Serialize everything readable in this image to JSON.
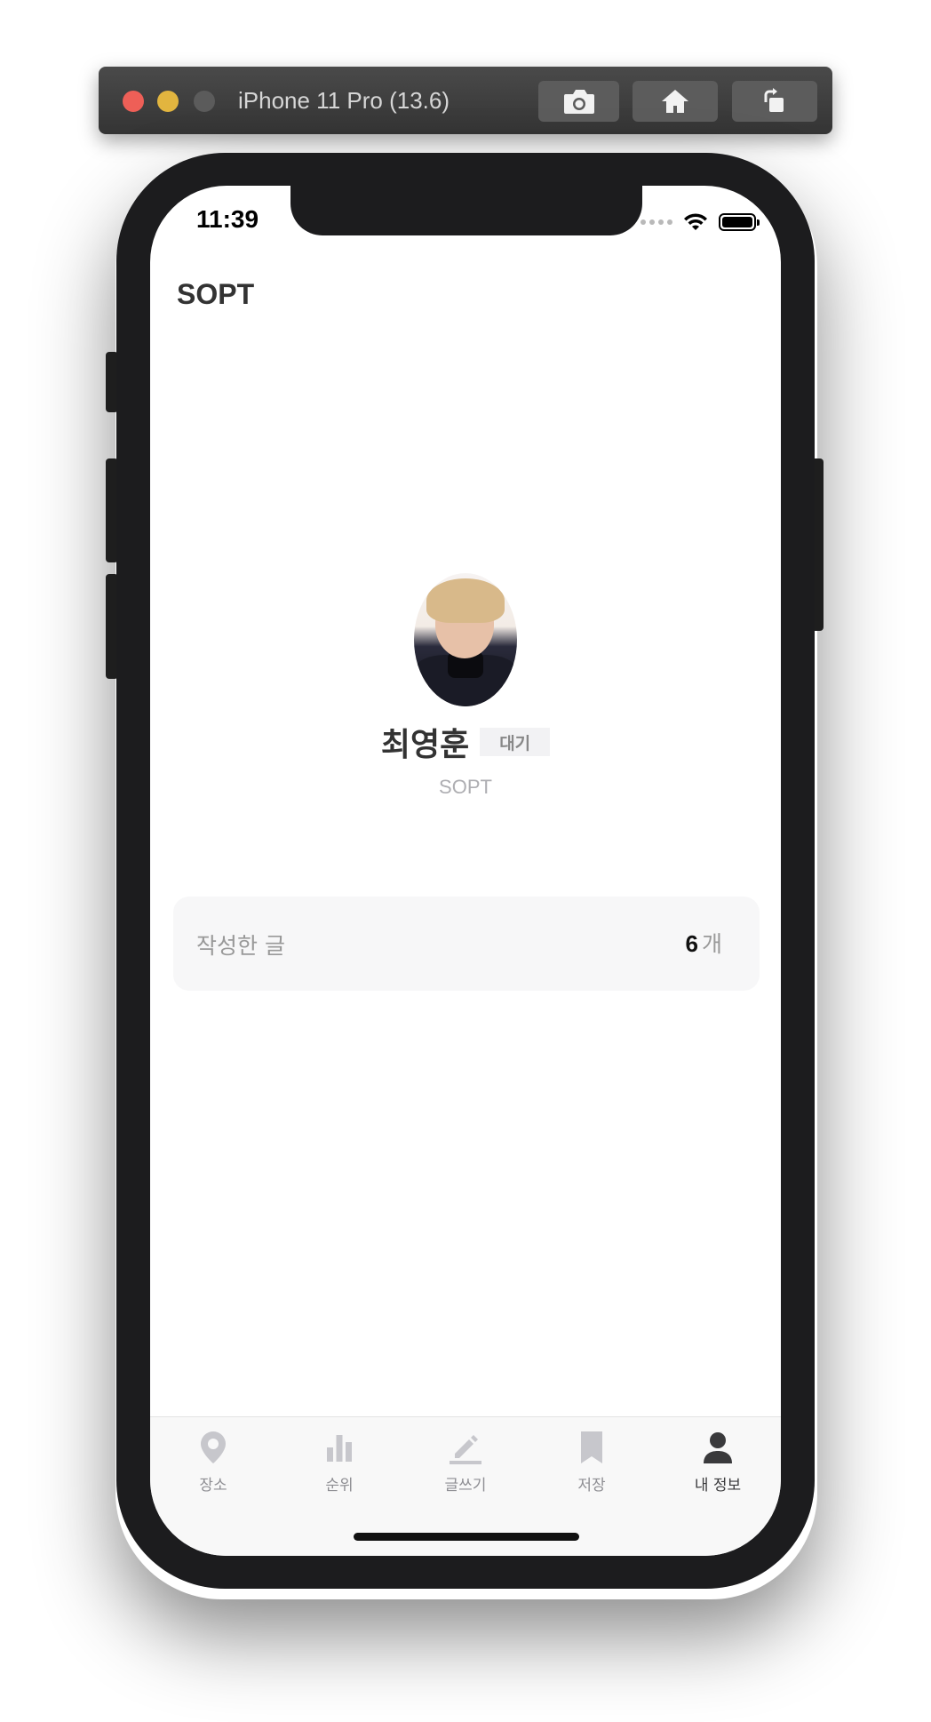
{
  "simulator": {
    "title": "iPhone 11 Pro (13.6)",
    "buttons": [
      "screenshot-icon",
      "home-icon",
      "rotate-icon"
    ]
  },
  "status_bar": {
    "time": "11:39",
    "icons": [
      "signal-dots-icon",
      "wifi-icon",
      "battery-icon"
    ]
  },
  "nav": {
    "title": "SOPT"
  },
  "profile": {
    "name": "최영훈",
    "badge": "대기",
    "organization": "SOPT"
  },
  "stats": {
    "label": "작성한 글",
    "count": "6",
    "unit": "개"
  },
  "tabbar": {
    "items": [
      {
        "label": "장소",
        "icon": "location-pin-icon",
        "active": false
      },
      {
        "label": "순위",
        "icon": "bar-chart-icon",
        "active": false
      },
      {
        "label": "글쓰기",
        "icon": "pencil-icon",
        "active": false
      },
      {
        "label": "저장",
        "icon": "bookmark-icon",
        "active": false
      },
      {
        "label": "내 정보",
        "icon": "person-icon",
        "active": true
      }
    ]
  },
  "colors": {
    "tab_inactive": "#c7c7cc",
    "tab_active": "#3a3a3c",
    "card_background": "#f7f7f8",
    "badge_background": "#f2f2f4"
  }
}
